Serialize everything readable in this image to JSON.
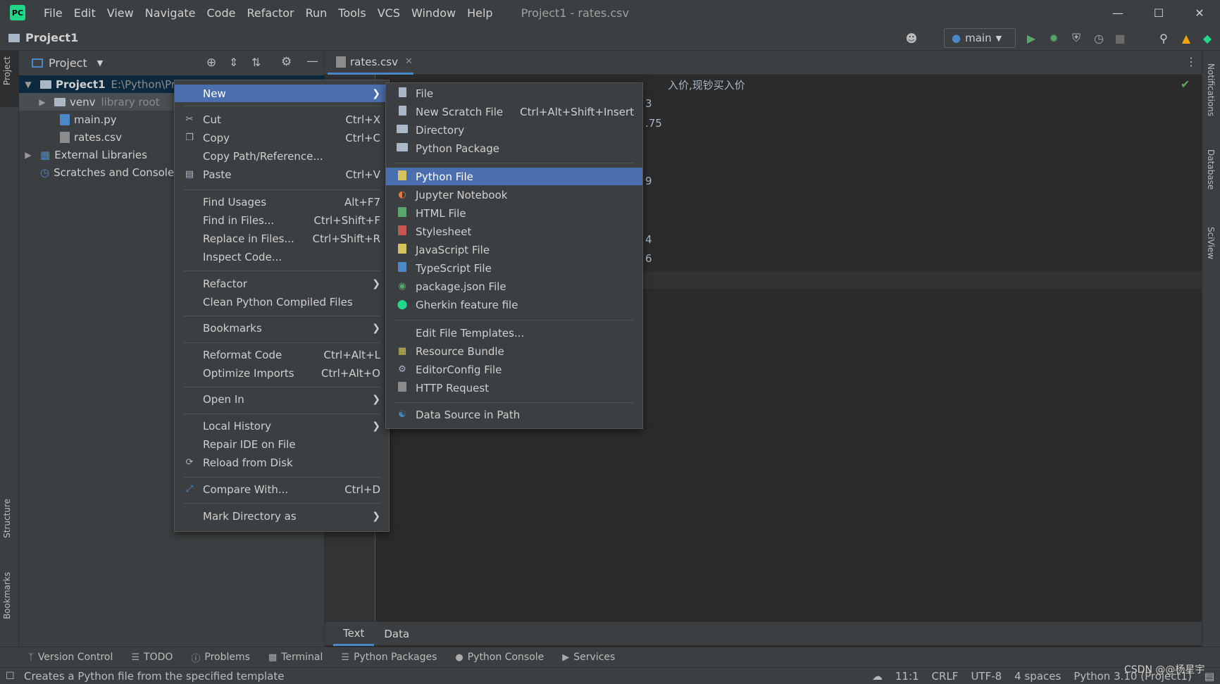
{
  "menubar": {
    "items": [
      "File",
      "Edit",
      "View",
      "Navigate",
      "Code",
      "Refactor",
      "Run",
      "Tools",
      "VCS",
      "Window",
      "Help"
    ],
    "window_title": "Project1 - rates.csv"
  },
  "toolbar": {
    "breadcrumb": "Project1",
    "run_config": "main"
  },
  "project_panel": {
    "title": "Project",
    "tree": {
      "root": {
        "name": "Project1",
        "path": "E:\\Python\\Pro"
      },
      "venv": {
        "name": "venv",
        "hint": "library root"
      },
      "main": "main.py",
      "rates": "rates.csv",
      "ext_libs": "External Libraries",
      "scratches": "Scratches and Consoles"
    }
  },
  "editor": {
    "tab": "rates.csv",
    "line1": "入价,现钞买入价",
    "frag": [
      "3",
      ".75",
      "9",
      "4",
      "6"
    ],
    "bottom_tabs": [
      "Text",
      "Data"
    ]
  },
  "context_menu": {
    "new": "New",
    "cut": {
      "label": "Cut",
      "shortcut": "Ctrl+X"
    },
    "copy": {
      "label": "Copy",
      "shortcut": "Ctrl+C"
    },
    "copy_path": "Copy Path/Reference...",
    "paste": {
      "label": "Paste",
      "shortcut": "Ctrl+V"
    },
    "find_usages": {
      "label": "Find Usages",
      "shortcut": "Alt+F7"
    },
    "find_in_files": {
      "label": "Find in Files...",
      "shortcut": "Ctrl+Shift+F"
    },
    "replace_in_files": {
      "label": "Replace in Files...",
      "shortcut": "Ctrl+Shift+R"
    },
    "inspect_code": "Inspect Code...",
    "refactor": "Refactor",
    "clean_python": "Clean Python Compiled Files",
    "bookmarks": "Bookmarks",
    "reformat_code": {
      "label": "Reformat Code",
      "shortcut": "Ctrl+Alt+L"
    },
    "optimize_imports": {
      "label": "Optimize Imports",
      "shortcut": "Ctrl+Alt+O"
    },
    "open_in": "Open In",
    "local_history": "Local History",
    "repair_ide": "Repair IDE on File",
    "reload": "Reload from Disk",
    "compare_with": {
      "label": "Compare With...",
      "shortcut": "Ctrl+D"
    },
    "mark_directory": "Mark Directory as"
  },
  "submenu_new": {
    "file": "File",
    "scratch": {
      "label": "New Scratch File",
      "shortcut": "Ctrl+Alt+Shift+Insert"
    },
    "directory": "Directory",
    "python_package": "Python Package",
    "python_file": "Python File",
    "jupyter": "Jupyter Notebook",
    "html": "HTML File",
    "stylesheet": "Stylesheet",
    "javascript": "JavaScript File",
    "typescript": "TypeScript File",
    "package_json": "package.json File",
    "gherkin": "Gherkin feature file",
    "edit_templates": "Edit File Templates...",
    "resource_bundle": "Resource Bundle",
    "editorconfig": "EditorConfig File",
    "http_request": "HTTP Request",
    "data_source": "Data Source in Path"
  },
  "toolwindows": [
    "Version Control",
    "TODO",
    "Problems",
    "Terminal",
    "Python Packages",
    "Python Console",
    "Services"
  ],
  "side_tabs": {
    "left_top": "Project",
    "left_structure": "Structure",
    "left_bookmarks": "Bookmarks",
    "right_notifications": "Notifications",
    "right_database": "Database",
    "right_sciview": "SciView"
  },
  "status": {
    "message": "Creates a Python file from the specified template",
    "position": "11:1",
    "line_sep": "CRLF",
    "encoding": "UTF-8",
    "indent": "4 spaces",
    "interpreter": "Python 3.10 (Project1)",
    "watermark": "CSDN @@杨星宇"
  },
  "colors": {
    "highlight": "#4b6eaf",
    "menu_bg": "#3c3f41",
    "editor_bg": "#2b2b2b"
  }
}
